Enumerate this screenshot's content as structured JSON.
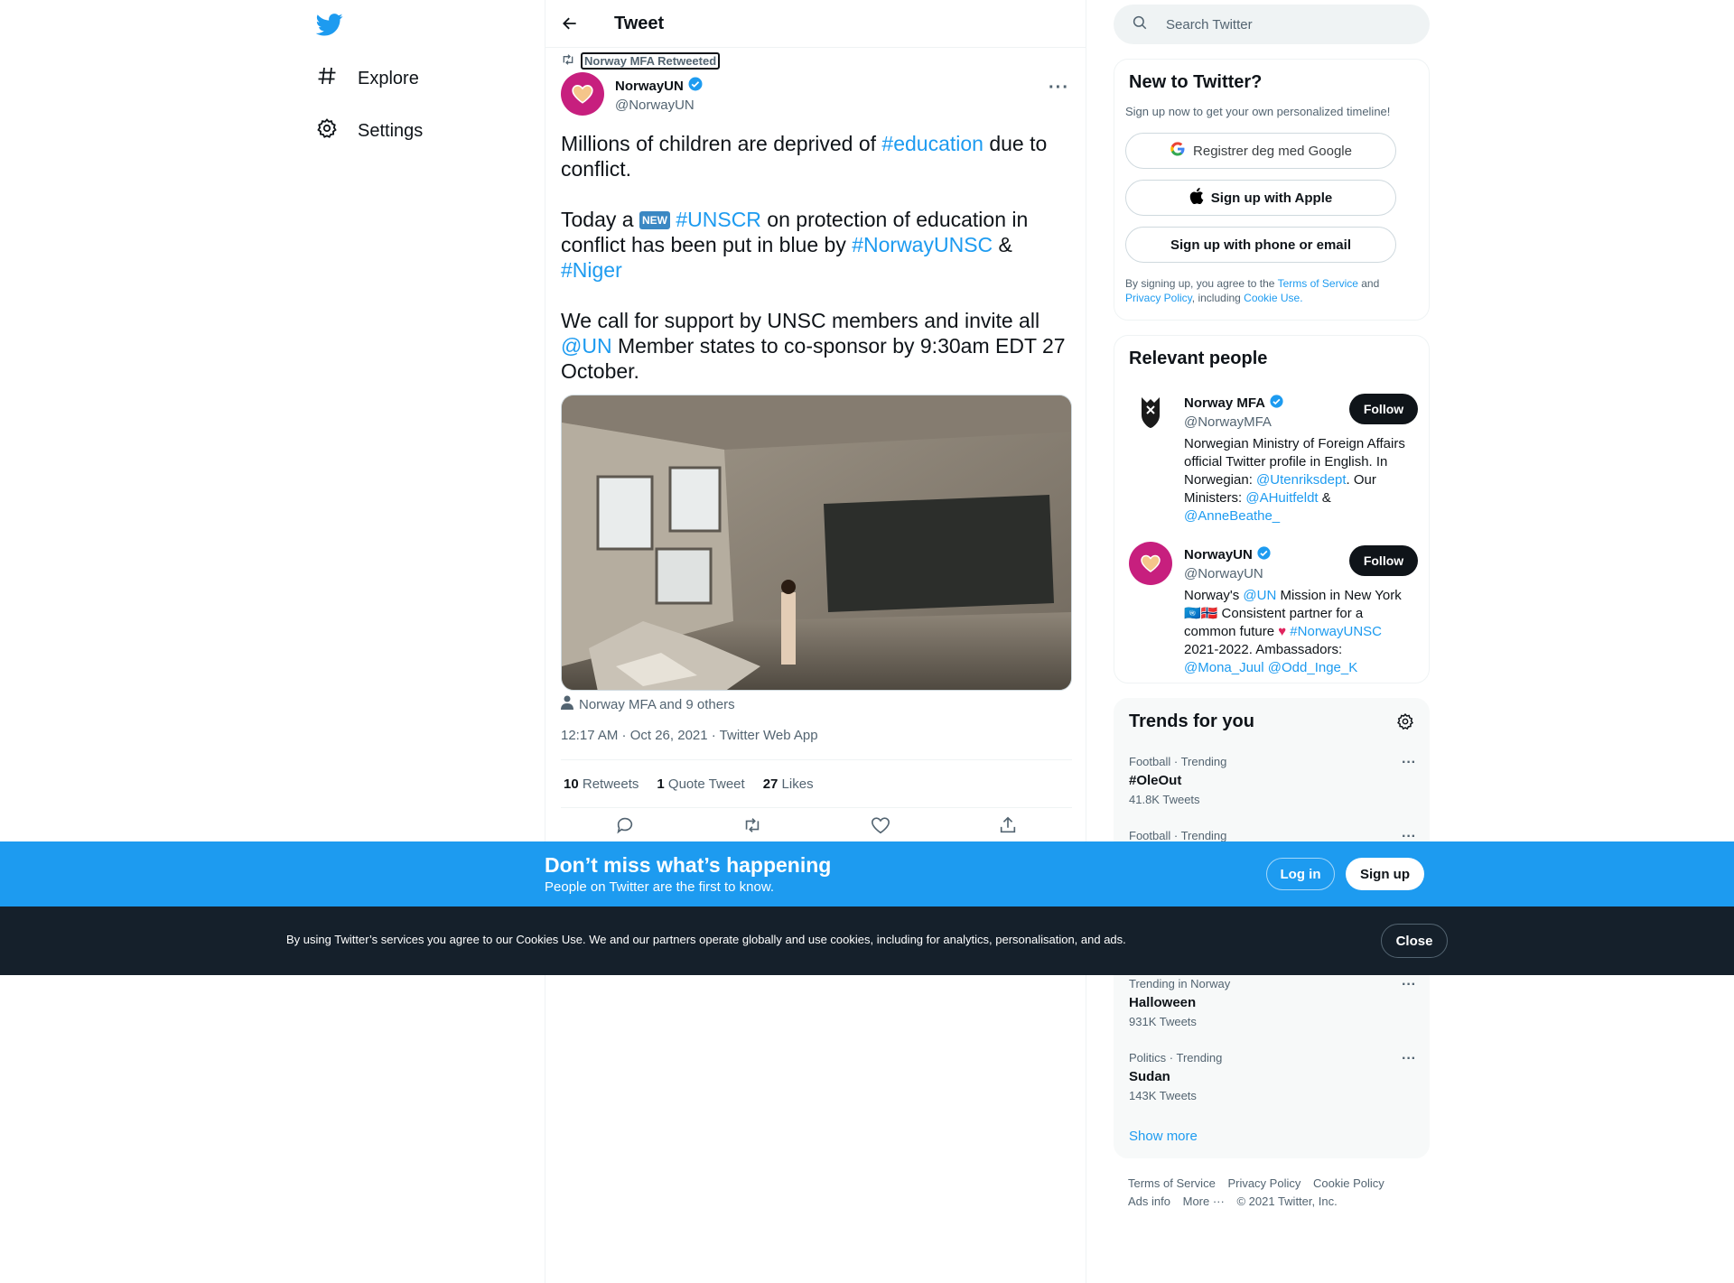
{
  "nav": {
    "explore": "Explore",
    "settings": "Settings"
  },
  "header": {
    "title": "Tweet"
  },
  "tweet": {
    "retweeted_by": "Norway MFA Retweeted",
    "author_name": "NorwayUN",
    "author_handle": "@NorwayUN",
    "text_1": "Millions of children are deprived of ",
    "tag_education": "#education",
    "text_2": " due to conflict.",
    "text_3": "Today a ",
    "new_badge": "NEW",
    "tag_unscr": "#UNSCR",
    "text_4": " on protection of education in conflict has been put in blue by ",
    "tag_norwayunsc": "#NorwayUNSC",
    "text_5": " & ",
    "tag_niger": "#Niger",
    "text_6": "We call for support by UNSC members and invite all ",
    "mention_un": "@UN",
    "text_7": " Member states to co-sponsor by 9:30am EDT 27 October.",
    "tagged": "Norway MFA and 9 others",
    "timestamp": "12:17 AM · Oct 26, 2021 · Twitter Web App",
    "retweets_count": "10",
    "retweets_label": "Retweets",
    "quotes_count": "1",
    "quotes_label": "Quote Tweet",
    "likes_count": "27",
    "likes_label": "Likes"
  },
  "search": {
    "placeholder": "Search Twitter"
  },
  "new_to_twitter": {
    "title": "New to Twitter?",
    "subtitle": "Sign up now to get your own personalized timeline!",
    "google": "Registrer deg med Google",
    "apple": "Sign up with Apple",
    "phone": "Sign up with phone or email",
    "legal_1": "By signing up, you agree to the ",
    "terms": "Terms of Service",
    "legal_2": " and ",
    "privacy": "Privacy Policy",
    "legal_3": ", including ",
    "cookie": "Cookie Use."
  },
  "relevant": {
    "title": "Relevant people",
    "people": [
      {
        "name": "Norway MFA",
        "handle": "@NorwayMFA",
        "follow": "Follow",
        "bio_1": "Norwegian Ministry of Foreign Affairs official Twitter profile in English. In Norwegian: ",
        "bio_m1": "@Utenriksdept",
        "bio_2": ". Our Ministers: ",
        "bio_m2": "@AHuitfeldt",
        "bio_3": " & ",
        "bio_m3": "@AnneBeathe_"
      },
      {
        "name": "NorwayUN",
        "handle": "@NorwayUN",
        "follow": "Follow",
        "bio_1": "Norway's ",
        "bio_m1": "@UN",
        "bio_2": " Mission in New York ",
        "bio_flags": "🇺🇳🇳🇴",
        "bio_3": " Consistent partner for a common future ",
        "bio_heart": "♥",
        "bio_tag": "#NorwayUNSC",
        "bio_4": " 2021-2022. Ambassadors: ",
        "bio_m2": "@Mona_Juul",
        "bio_m3": "@Odd_Inge_K"
      }
    ]
  },
  "trends": {
    "title": "Trends for you",
    "items": [
      {
        "context": "Football · Trending",
        "name": "#OleOut",
        "count": "41.8K Tweets"
      },
      {
        "context": "Football · Trending",
        "name": "",
        "count": ""
      },
      {
        "context": "Trending in Norway",
        "name": "Halloween",
        "count": "931K Tweets"
      },
      {
        "context": "Politics · Trending",
        "name": "Sudan",
        "count": "143K Tweets"
      }
    ],
    "show_more": "Show more"
  },
  "footer": {
    "terms": "Terms of Service",
    "privacy": "Privacy Policy",
    "cookie": "Cookie Policy",
    "ads": "Ads info",
    "more": "More ···",
    "copyright": "© 2021 Twitter, Inc."
  },
  "banner": {
    "title": "Don’t miss what’s happening",
    "subtitle": "People on Twitter are the first to know.",
    "login": "Log in",
    "signup": "Sign up"
  },
  "cookie_banner": {
    "text": "By using Twitter’s services you agree to our Cookies Use. We and our partners operate globally and use cookies, including for analytics, personalisation, and ads.",
    "close": "Close"
  },
  "colors": {
    "accent": "#1d9bf0",
    "dark": "#0f1419",
    "muted": "#536471",
    "cookie_bg": "#15202b",
    "avatar_pink": "#c71f7e"
  },
  "icons": [
    "twitter-logo-icon",
    "hashtag-icon",
    "gear-icon",
    "back-arrow-icon",
    "retweet-icon",
    "verified-icon",
    "more-icon",
    "person-icon",
    "reply-icon",
    "like-icon",
    "share-icon",
    "search-icon",
    "google-icon",
    "apple-icon"
  ]
}
